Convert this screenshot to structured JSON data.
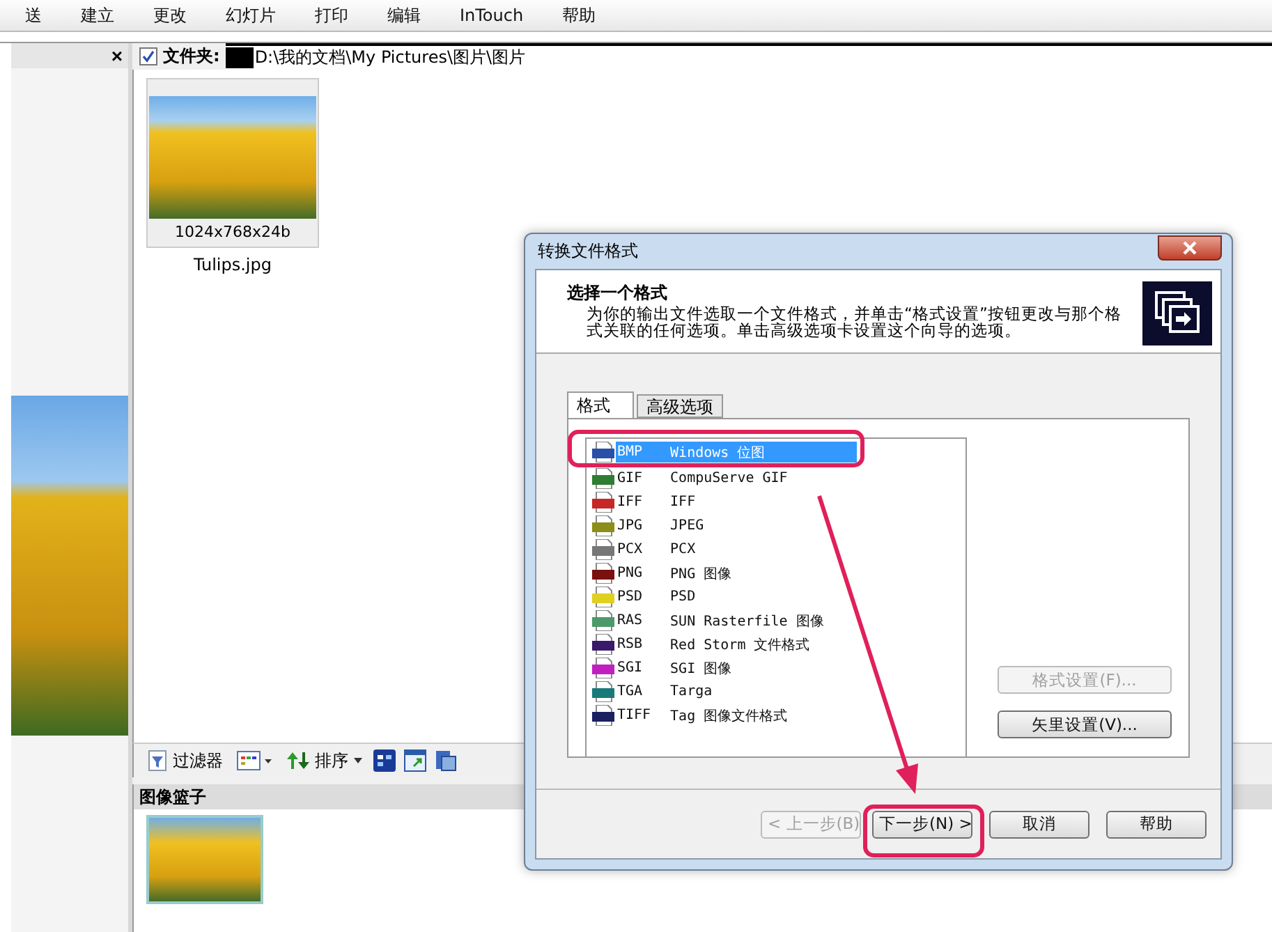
{
  "toolbar": {
    "items": [
      "送",
      "建立",
      "更改",
      "幻灯片",
      "打印",
      "编辑",
      "InTouch",
      "帮助"
    ]
  },
  "side_panel": {
    "close": "×"
  },
  "folder_bar": {
    "checked": true,
    "label": "文件夹:",
    "path": "D:\\我的文档\\My Pictures\\图片\\图片"
  },
  "thumbnails": [
    {
      "info": "1024x768x24b",
      "name": "Tulips.jpg"
    }
  ],
  "bottom_toolbar": {
    "filter": "过滤器",
    "sort": "排序"
  },
  "basket": {
    "title": "图像篮子"
  },
  "dialog": {
    "title": "转换文件格式",
    "heading": "选择一个格式",
    "description": "为你的输出文件选取一个文件格式，并单击“格式设置”按钮更改与那个格式关联的任何选项。单击高级选项卡设置这个向导的选项。",
    "tabs": [
      {
        "label": "格式",
        "selected": true
      },
      {
        "label": "高级选项",
        "selected": false
      }
    ],
    "formats": [
      {
        "code": "BMP",
        "name": "Windows 位图",
        "color": "#2a4fa8",
        "selected": true
      },
      {
        "code": "GIF",
        "name": "CompuServe GIF",
        "color": "#2e7d32",
        "selected": false
      },
      {
        "code": "IFF",
        "name": "IFF",
        "color": "#c62828",
        "selected": false
      },
      {
        "code": "JPG",
        "name": "JPEG",
        "color": "#8d8d1a",
        "selected": false
      },
      {
        "code": "PCX",
        "name": "PCX",
        "color": "#777777",
        "selected": false
      },
      {
        "code": "PNG",
        "name": "PNG 图像",
        "color": "#7a1010",
        "selected": false
      },
      {
        "code": "PSD",
        "name": "PSD",
        "color": "#e0d020",
        "selected": false
      },
      {
        "code": "RAS",
        "name": "SUN Rasterfile 图像",
        "color": "#4c9a6a",
        "selected": false
      },
      {
        "code": "RSB",
        "name": "Red Storm 文件格式",
        "color": "#3a1a6a",
        "selected": false
      },
      {
        "code": "SGI",
        "name": "SGI 图像",
        "color": "#c020c0",
        "selected": false
      },
      {
        "code": "TGA",
        "name": "Targa",
        "color": "#1a7a7a",
        "selected": false
      },
      {
        "code": "TIFF",
        "name": "Tag 图像文件格式",
        "color": "#1a2060",
        "selected": false
      }
    ],
    "side_buttons": [
      {
        "label": "格式设置(F)...",
        "disabled": true
      },
      {
        "label": "矢里设置(V)...",
        "disabled": false
      }
    ],
    "footer_buttons": [
      {
        "label": "< 上一步(B)",
        "disabled": true
      },
      {
        "label": "下一步(N) >",
        "disabled": false
      },
      {
        "label": "取消",
        "disabled": false
      },
      {
        "label": "帮助",
        "disabled": false
      }
    ]
  }
}
